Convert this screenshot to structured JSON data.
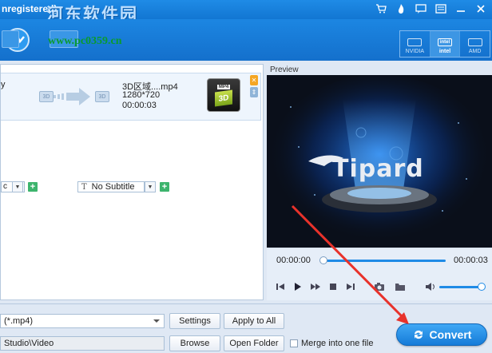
{
  "titlebar": {
    "title": "nregistered)",
    "watermark": "河东软件园",
    "icons": [
      "cart-icon",
      "flame-icon",
      "feedback-icon",
      "menu-icon",
      "minimize-icon",
      "close-icon"
    ]
  },
  "toolbar": {
    "watermark_url": "www.pc0359.cn",
    "gpu": [
      {
        "label": "NVIDIA",
        "chip": "",
        "active": false
      },
      {
        "label": "intel",
        "chip": "intel",
        "active": true
      },
      {
        "label": "AMD",
        "chip": "",
        "active": false
      }
    ]
  },
  "file_item": {
    "source_trunc": "y",
    "output_name": "3D区域....mp4",
    "output_resolution": "1280*720",
    "output_duration": "00:00:03",
    "thumb_tag": "MP4",
    "thumb_label": "3D",
    "audio_value": "c",
    "subtitle_value": "No Subtitle",
    "subtitle_prefix": "T"
  },
  "preview": {
    "label": "Preview",
    "logo_text": "Tipard",
    "time_current": "00:00:00",
    "time_total": "00:00:03",
    "progress_fraction": 0.0,
    "volume_fraction": 1.0
  },
  "bottom": {
    "profile_value": "(*.mp4)",
    "destination_value": "Studio\\Video",
    "settings_label": "Settings",
    "apply_all_label": "Apply to All",
    "browse_label": "Browse",
    "open_folder_label": "Open Folder",
    "merge_label": "Merge into one file",
    "convert_label": "Convert"
  },
  "colors": {
    "accent": "#1f8be6",
    "convert": "#1a82dd",
    "annotation_arrow": "#e8322b"
  }
}
